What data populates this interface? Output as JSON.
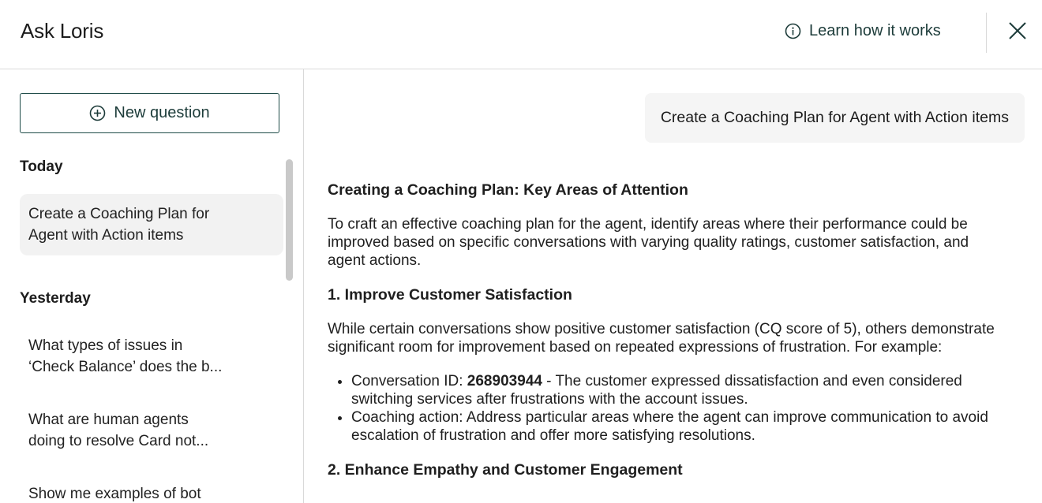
{
  "header": {
    "title": "Ask Loris",
    "learn_link": "Learn how it works"
  },
  "sidebar": {
    "new_question_label": "New question",
    "today_label": "Today",
    "today_items": [
      {
        "line1": "Create a Coaching Plan for",
        "line2": "Agent with Action items"
      }
    ],
    "yesterday_label": "Yesterday",
    "yesterday_items": [
      {
        "line1": "What types of issues in",
        "line2": "‘Check Balance’ does the b..."
      },
      {
        "line1": "What are human agents",
        "line2": "doing to resolve Card not..."
      },
      {
        "line1": "Show me examples of bot",
        "line2": ""
      }
    ]
  },
  "conversation": {
    "user_message": "Create a Coaching Plan for Agent with Action items",
    "answer": {
      "heading": "Creating a Coaching Plan: Key Areas of Attention",
      "intro": "To craft an effective coaching plan for the agent, identify areas where their performance could be improved based on specific conversations with varying quality ratings, customer satisfaction, and agent actions.",
      "section1_title": "1. Improve Customer Satisfaction",
      "section1_text": "While certain conversations show positive customer satisfaction (CQ score of 5), others demonstrate significant room for improvement based on repeated expressions of frustration. For example:",
      "bullet1_prefix": "Conversation ID: ",
      "bullet1_id": "268903944",
      "bullet1_rest": " - The customer expressed dissatisfaction and even considered switching services after frustrations with the account issues.",
      "bullet2": "Coaching action: Address particular areas where the agent can improve communication to avoid escalation of frustration and offer more satisfying resolutions.",
      "section2_title": "2. Enhance Empathy and Customer Engagement"
    }
  },
  "icons": {
    "info": "info-icon",
    "close": "close-icon",
    "plus": "plus-circle-icon"
  },
  "colors": {
    "accent": "#1d3c3a",
    "border": "#d9d9d9",
    "active_item_bg": "#f2f2f2",
    "bubble_bg": "#f5f5f5"
  }
}
